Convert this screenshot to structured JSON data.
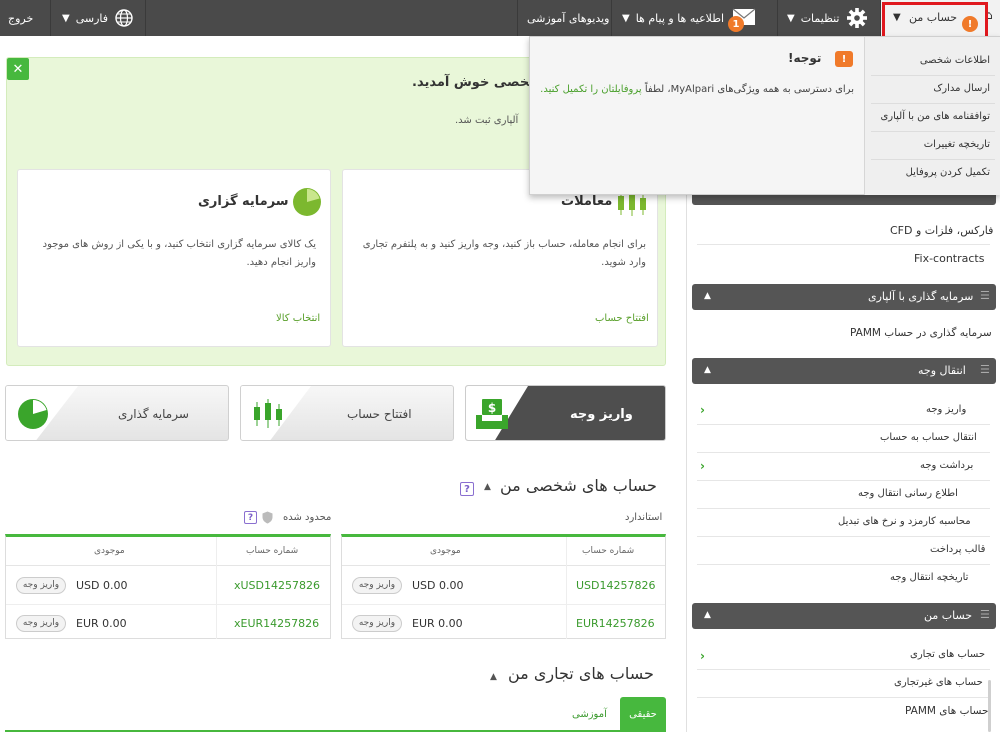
{
  "topbar": {
    "logout": "خروج",
    "language": "فارسی",
    "videos": "ویدیوهای آموزشی",
    "news": "اطلاعیه ها و پیام ها",
    "news_badge": "1",
    "settings": "تنظیمات",
    "my_account": "حساب من",
    "account_badge": "!"
  },
  "dropdown": {
    "notice_title": "توجه!",
    "notice_badge": "!",
    "notice_text": "برای دسترسی به همه ویژگی‌های MyAlpari، لطفاً",
    "notice_link": "پروفایلتان را تکمیل کنید.",
    "menu": [
      "اطلاعات شخصی",
      "ارسال مدارک",
      "توافقنامه های من با آلپاری",
      "تاریخچه تغییرات",
      "تکمیل کردن پروفایل"
    ]
  },
  "welcome": {
    "title": "شخصی خوش آمدید.",
    "subtitle": "آلپاری ثبت شد.",
    "close_label": "✕",
    "invest_title": "سرمایه گزاری",
    "invest_text": "یک کالای سرمایه گزاری انتخاب کنید، و با یکی از روش های موجود واریز انجام دهید.",
    "invest_link": "انتخاب کالا",
    "trade_title": "معاملات",
    "trade_text": "برای انجام معامله، حساب باز کنید، وجه واریز کنید و به پلتفرم تجاری وارد شوید.",
    "trade_link": "افتتاح حساب"
  },
  "actions": {
    "deposit": "واریز وجه",
    "open_account": "افتتاح حساب",
    "invest": "سرمایه گذاری"
  },
  "personal": {
    "title": "حساب های شخصی من",
    "help": "?",
    "standard": "استاندارد",
    "limited": "محدود شده",
    "col_account": "شماره حساب",
    "col_balance": "موجودی",
    "deposit_btn": "واریز وجه",
    "standard_rows": [
      {
        "account": "USD14257826",
        "balance": "USD 0.00"
      },
      {
        "account": "EUR14257826",
        "balance": "EUR 0.00"
      }
    ],
    "limited_rows": [
      {
        "account": "xUSD14257826",
        "balance": "USD 0.00"
      },
      {
        "account": "xEUR14257826",
        "balance": "EUR 0.00"
      }
    ]
  },
  "trading": {
    "title": "حساب های تجاری من",
    "tab_real": "حقیقی",
    "tab_demo": "آموزشی"
  },
  "sidebar": {
    "forex": "فارکس، فلزات و CFD",
    "fix": "Fix-contracts",
    "invest_head": "سرمایه گذاری با آلپاری",
    "pamm_invest": "سرمایه گذاری در حساب PAMM",
    "transfer_head": "انتقال وجه",
    "transfer_items": [
      "واریز وجه",
      "انتقال حساب به حساب",
      "برداشت وجه",
      "اطلاع رسانی انتقال وجه",
      "محاسبه کارمزد و نرخ های تبدیل",
      "قالب پرداخت",
      "تاریخچه انتقال وجه"
    ],
    "myaccount_head": "حساب من",
    "myaccount_items": [
      "حساب های تجاری",
      "حساب های غیرتجاری",
      "حساب های PAMM"
    ]
  }
}
